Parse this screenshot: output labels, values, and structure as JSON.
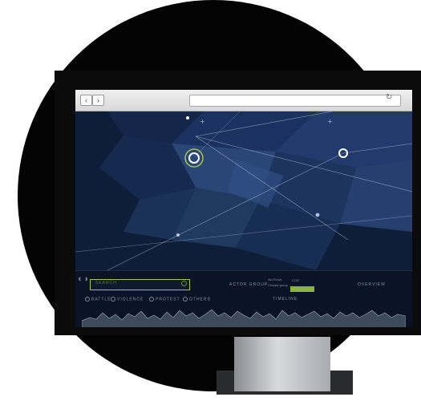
{
  "browser": {
    "back_glyph": "‹",
    "forward_glyph": "›",
    "reload_glyph": "↻"
  },
  "panel": {
    "search_placeholder": "SEARCH",
    "filter_label": "ACTOR GROUP",
    "small_label_1": "Aid Flows",
    "small_label_2": "Climate group",
    "small_label_3": "COR",
    "right_label": "OVERVIEW",
    "tab_1": "BATTLE",
    "tab_2": "VIOLENCE",
    "tab_3": "PROTEST",
    "tab_4": "OTHERS",
    "timeline_label": "TIMELINE"
  },
  "colors": {
    "accent": "#a7c44a",
    "map_bg": "#0e1a30"
  }
}
